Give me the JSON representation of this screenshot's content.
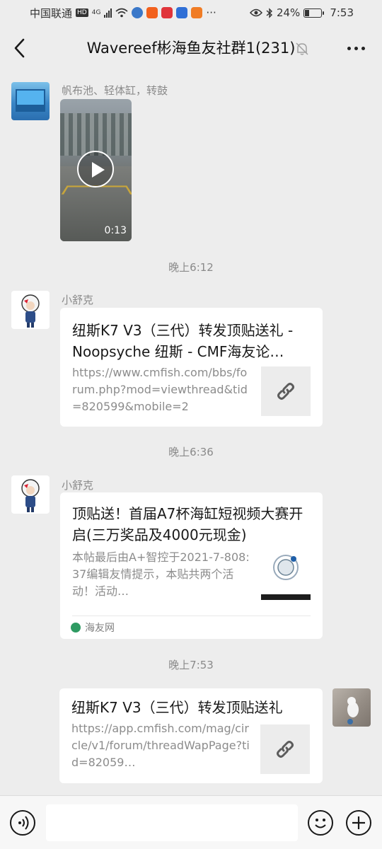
{
  "status_bar": {
    "carrier": "中国联通",
    "hd": "HD",
    "network": "4G",
    "more": "···",
    "battery": "24%",
    "time": "7:53"
  },
  "header": {
    "title": "Wavereef彬海鱼友社群1(231)"
  },
  "messages": [
    {
      "type": "video",
      "sender": "帆布池、轻体缸，转鼓",
      "duration": "0:13"
    },
    {
      "type": "time",
      "text": "晚上6:12"
    },
    {
      "type": "link",
      "sender": "小舒克",
      "title": "纽斯K7 V3（三代）转发顶贴送礼 - Noopsyche 纽斯 - CMF海友论…",
      "desc": "https://www.cmfish.com/bbs/forum.php?mod=viewthread&tid=820599&mobile=2"
    },
    {
      "type": "time",
      "text": "晚上6:36"
    },
    {
      "type": "link",
      "sender": "小舒克",
      "title": "顶贴送！首届A7杯海缸短视频大赛开启(三万奖品及4000元现金)",
      "desc": "本帖最后由A+智控于2021-7-808:37编辑友情提示，本贴共两个活动！活动…",
      "source": "海友网"
    },
    {
      "type": "time",
      "text": "晚上7:53"
    },
    {
      "type": "link",
      "self": true,
      "title": "纽斯K7 V3（三代）转发顶贴送礼",
      "desc": "https://app.cmfish.com/mag/circle/v1/forum/threadWapPage?tid=82059…"
    }
  ],
  "input": {
    "value": ""
  },
  "colors": {
    "background": "#ededed",
    "card": "#ffffff",
    "secondary_text": "#8c8c8c",
    "source_icon": "#2e9a62"
  }
}
